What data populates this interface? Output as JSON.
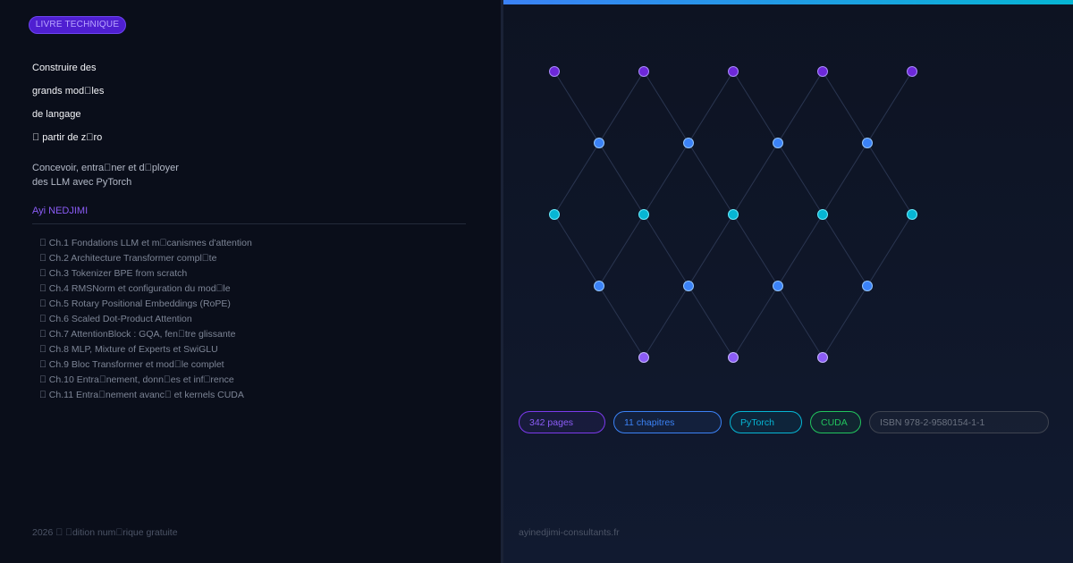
{
  "cover": {
    "tag": "LIVRE TECHNIQUE",
    "title_lines": [
      "Construire des",
      "grands mod\u0000les",
      "de langage",
      "\u0000 partir de z\u0000ro"
    ],
    "subtitle_lines": [
      "Concevoir, entra\u0000ner et d\u0000ployer",
      "des LLM avec PyTorch"
    ],
    "author": "Ayi NEDJIMI",
    "chapters": [
      "\u0000 Ch.1  Fondations LLM et m\u0000canismes d'attention",
      "\u0000 Ch.2  Architecture Transformer compl\u0000te",
      "\u0000 Ch.3  Tokenizer BPE from scratch",
      "\u0000 Ch.4  RMSNorm et configuration du mod\u0000le",
      "\u0000 Ch.5  Rotary Positional Embeddings (RoPE)",
      "\u0000 Ch.6  Scaled Dot-Product Attention",
      "\u0000 Ch.7  AttentionBlock : GQA, fen\u0000tre glissante",
      "\u0000 Ch.8  MLP, Mixture of Experts et SwiGLU",
      "\u0000 Ch.9  Bloc Transformer et mod\u0000le complet",
      "\u0000 Ch.10  Entra\u0000nement, donn\u0000es et inf\u0000rence",
      "\u0000 Ch.11  Entra\u0000nement avanc\u0000 et kernels CUDA"
    ],
    "edition": "2026 \u0000 \u0000dition num\u0000rique gratuite",
    "website": "ayinedjimi-consultants.fr"
  },
  "badges": {
    "pages": "342 pages",
    "chapters": "11 chapitres",
    "framework": "PyTorch",
    "gpu": "CUDA",
    "isbn": "ISBN 978-2-9580154-1-1"
  },
  "colors": {
    "violet": "#7c3aed",
    "blue": "#3b82f6",
    "cyan": "#06b6d4",
    "green": "#22c55e",
    "gray": "#6b7280"
  }
}
